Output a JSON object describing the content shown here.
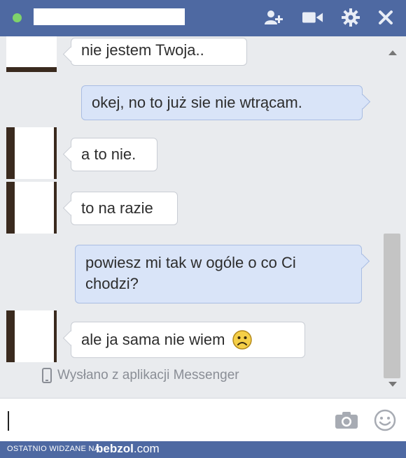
{
  "window": {
    "actions": [
      "add-friend-icon",
      "video-call-icon",
      "settings-gear-icon",
      "close-icon"
    ]
  },
  "messages": [
    {
      "direction": "in",
      "text": "nie jestem Twoja.."
    },
    {
      "direction": "out",
      "text": "okej, no to już sie nie wtrącam."
    },
    {
      "direction": "in",
      "text": "a to nie."
    },
    {
      "direction": "in",
      "text": "to na razie"
    },
    {
      "direction": "out",
      "text": "powiesz mi tak w ogóle o co Ci chodzi?"
    },
    {
      "direction": "in",
      "text": "ale ja sama nie wiem",
      "emoji": "sad-face-icon"
    }
  ],
  "sent_from": "Wysłano z aplikacji Messenger",
  "composer": {
    "value": "",
    "icons": [
      "camera-icon",
      "smiley-icon"
    ]
  },
  "footer": {
    "label": "OSTATNIO WIDZANE NA",
    "brand_main": "bebzol",
    "brand_tld": ".com"
  },
  "colors": {
    "titlebar": "#4e69a2",
    "online": "#7fd36b",
    "incoming_bubble": "#ffffff",
    "outgoing_bubble": "#d9e4f8",
    "chat_background": "#e9ebee"
  }
}
